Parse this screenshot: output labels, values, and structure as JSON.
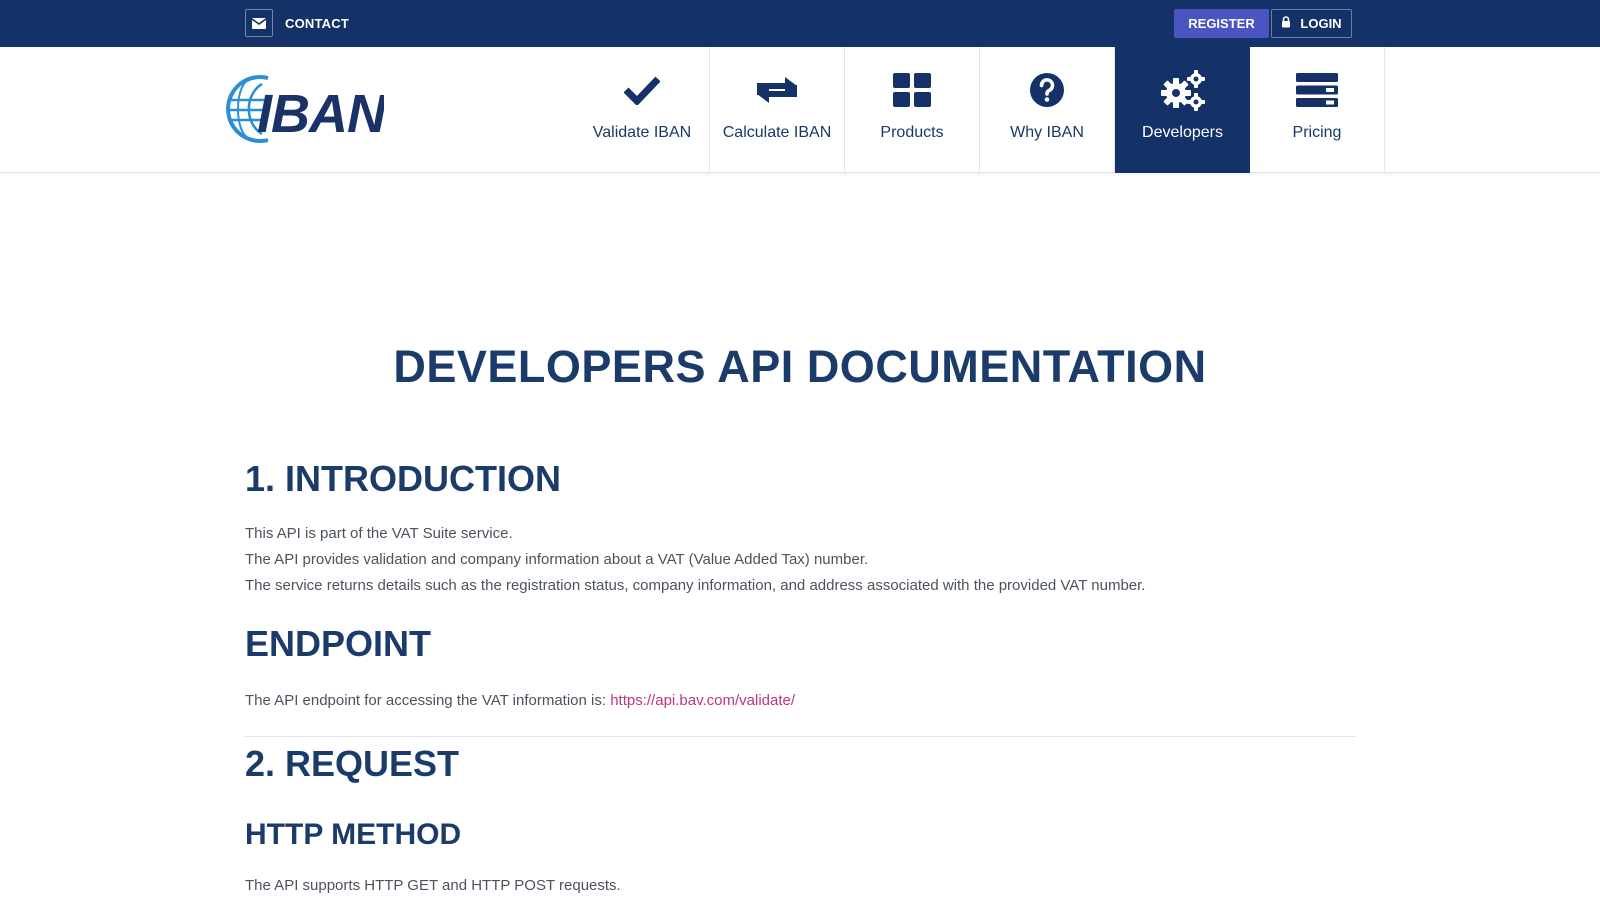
{
  "topbar": {
    "contact_label": "CONTACT",
    "register_label": "REGISTER",
    "login_label": "LOGIN",
    "contact_icon": "envelope-icon",
    "login_icon": "lock-icon"
  },
  "logo": {
    "text": "IBAN"
  },
  "nav": {
    "items": [
      {
        "label": "Validate IBAN",
        "icon": "checkmark-icon",
        "active": false
      },
      {
        "label": "Calculate IBAN",
        "icon": "exchange-icon",
        "active": false
      },
      {
        "label": "Products",
        "icon": "grid-icon",
        "active": false
      },
      {
        "label": "Why IBAN",
        "icon": "question-icon",
        "active": false
      },
      {
        "label": "Developers",
        "icon": "gears-icon",
        "active": true
      },
      {
        "label": "Pricing",
        "icon": "server-icon",
        "active": false
      }
    ]
  },
  "main": {
    "title": "DEVELOPERS API DOCUMENTATION",
    "intro_heading": "1. INTRODUCTION",
    "intro_lines": [
      "This API is part of the VAT Suite service.",
      "The API provides validation and company information about a VAT (Value Added Tax) number.",
      "The service returns details such as the registration status, company information, and address associated with the provided VAT number."
    ],
    "endpoint_heading": "ENDPOINT",
    "endpoint_text": "The API endpoint for accessing the VAT information is:",
    "endpoint_url": "https://api.bav.com/validate/",
    "request_heading": "2. REQUEST",
    "http_method_heading": "HTTP METHOD",
    "http_method_text": "The API supports HTTP GET and HTTP POST requests."
  },
  "colors": {
    "navy": "#143168",
    "heading": "#1b3c6a",
    "register": "#4a55c2",
    "link": "#c0357a"
  }
}
